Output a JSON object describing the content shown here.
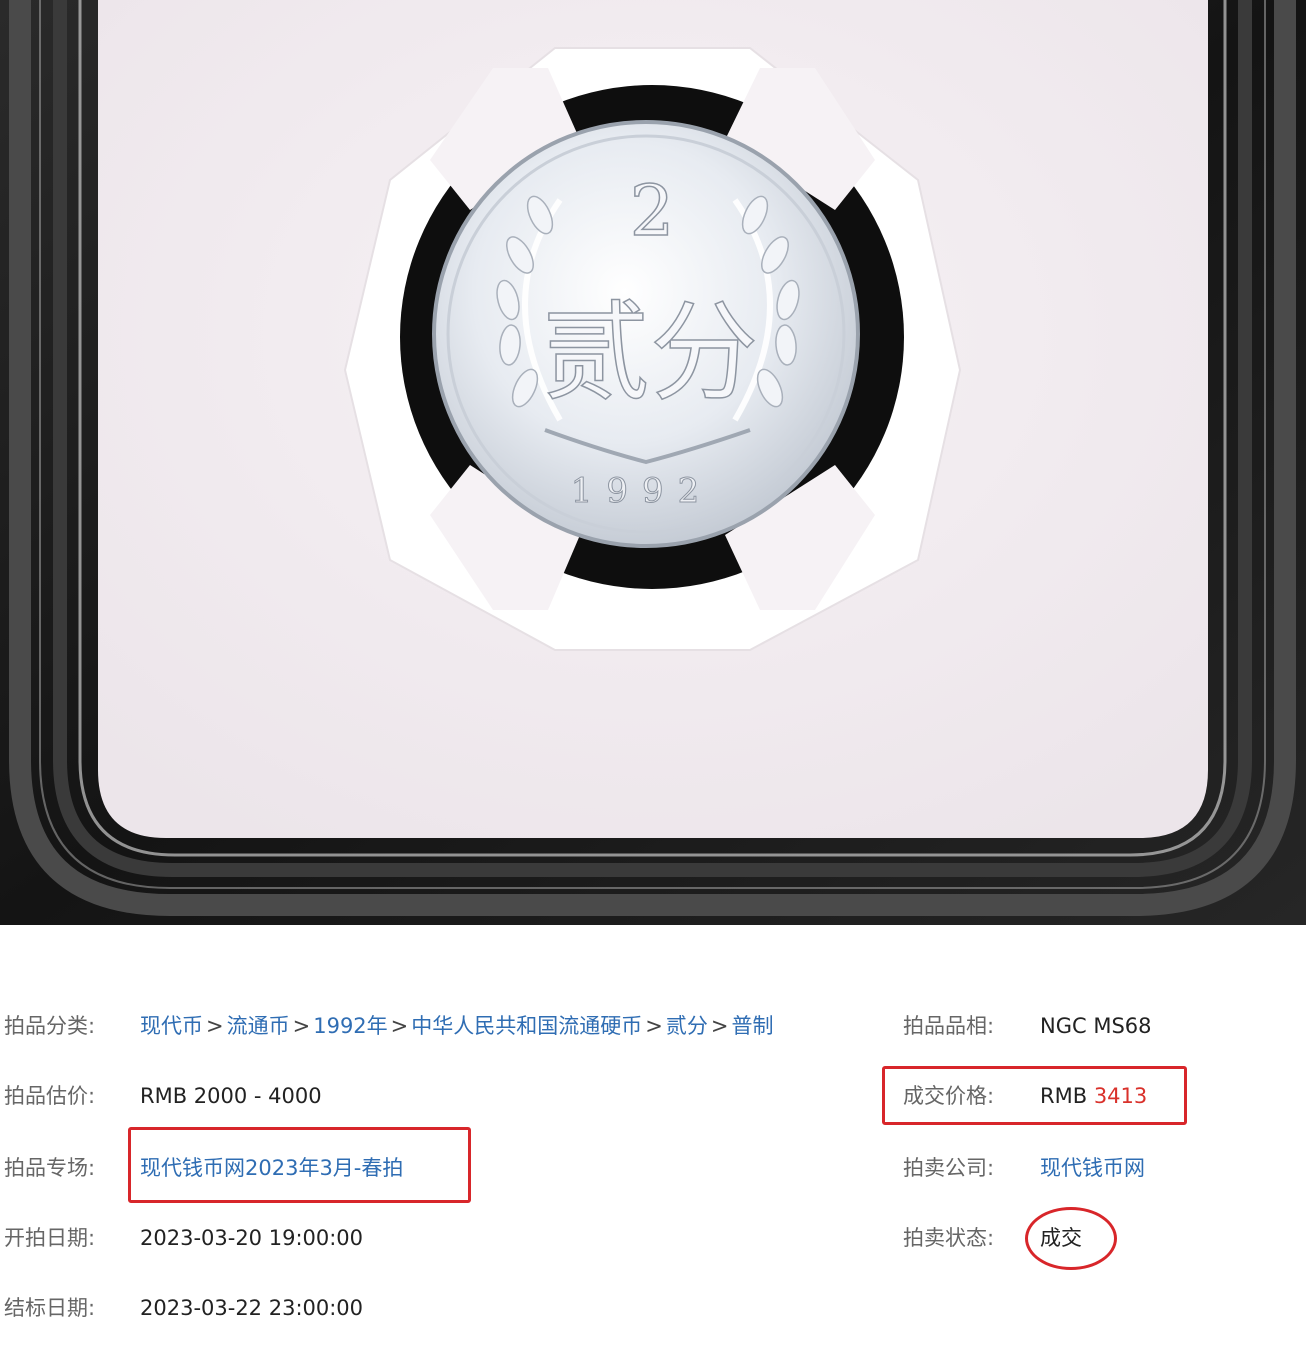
{
  "photo": {
    "coin_denomination_numeral": "2",
    "coin_characters": "贰分",
    "coin_year": "1992",
    "colors": {
      "slab_dark": "#121212",
      "insert": "#f4eef1",
      "coin": "#e4e8ee"
    }
  },
  "info": {
    "category": {
      "label": "拍品分类:",
      "crumbs": [
        "现代币",
        "流通币",
        "1992年",
        "中华人民共和国流通硬币",
        "贰分",
        "普制"
      ],
      "separator": ">"
    },
    "estimate": {
      "label": "拍品估价:",
      "value": "RMB 2000 - 4000"
    },
    "session": {
      "label": "拍品专场:",
      "value": "现代钱币网2023年3月-春拍"
    },
    "start_date": {
      "label": "开拍日期:",
      "value": "2023-03-20 19:00:00"
    },
    "end_date": {
      "label": "结标日期:",
      "value": "2023-03-22 23:00:00"
    },
    "grade": {
      "label": "拍品品相:",
      "value": "NGC MS68"
    },
    "hammer_price": {
      "label": "成交价格:",
      "currency": "RMB",
      "value": "3413"
    },
    "auction_house": {
      "label": "拍卖公司:",
      "value": "现代钱币网"
    },
    "status": {
      "label": "拍卖状态:",
      "value": "成交"
    }
  },
  "colors": {
    "link": "#2f6db3",
    "highlight_red": "#d8262a",
    "price_red": "#d9312b",
    "label_gray": "#666666"
  }
}
